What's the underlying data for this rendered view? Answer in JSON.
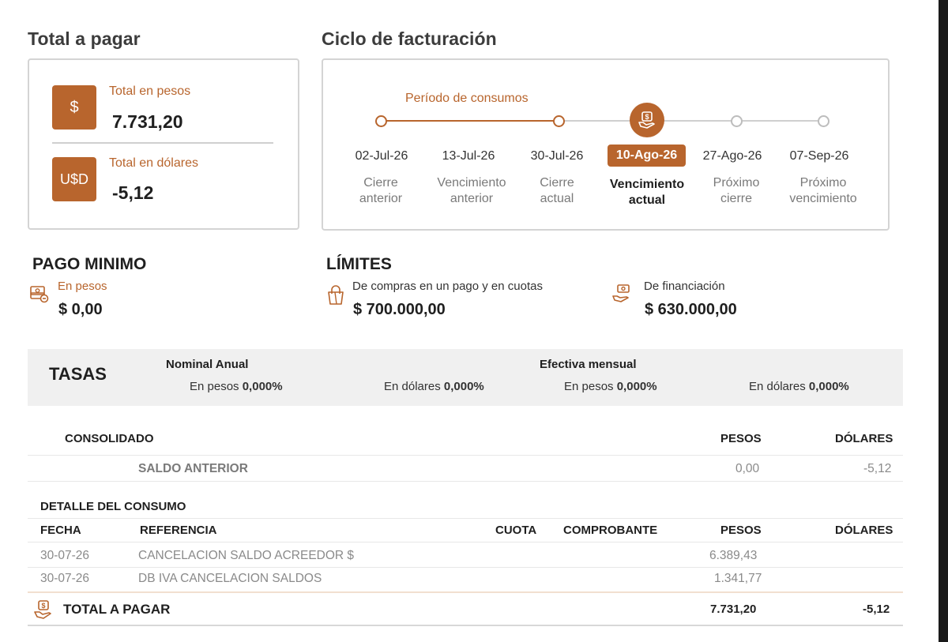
{
  "total": {
    "title": "Total a pagar",
    "pesos": {
      "icon": "dollar-sign-icon",
      "symbol": "$",
      "label": "Total en pesos",
      "value": "7.731,20"
    },
    "dolares": {
      "icon": "usd-sign-icon",
      "symbol": "U$D",
      "label": "Total en dólares",
      "value": "-5,12"
    }
  },
  "ciclo": {
    "title": "Ciclo de facturación",
    "period_label": "Período de consumos",
    "steps": [
      {
        "date": "02-Jul-26",
        "desc1": "Cierre",
        "desc2": "anterior"
      },
      {
        "date": "13-Jul-26",
        "desc1": "Vencimiento",
        "desc2": "anterior"
      },
      {
        "date": "30-Jul-26",
        "desc1": "Cierre",
        "desc2": "actual"
      },
      {
        "date": "10-Ago-26",
        "desc1": "Vencimiento",
        "desc2": "actual"
      },
      {
        "date": "27-Ago-26",
        "desc1": "Próximo",
        "desc2": "cierre"
      },
      {
        "date": "07-Sep-26",
        "desc1": "Próximo",
        "desc2": "vencimiento"
      }
    ]
  },
  "pago_minimo": {
    "title": "PAGO MINIMO",
    "label": "En pesos",
    "value": "$ 0,00"
  },
  "limites": {
    "title": "LÍMITES",
    "compras": {
      "label": "De compras en un pago y en cuotas",
      "value": "$ 700.000,00"
    },
    "financiacion": {
      "label": "De financiación",
      "value": "$ 630.000,00"
    }
  },
  "tasas": {
    "title": "TASAS",
    "nominal_title": "Nominal Anual",
    "efectiva_title": "Efectiva mensual",
    "en_pesos": "En pesos",
    "en_dolares": "En dólares",
    "value": "0,000%"
  },
  "consolidado": {
    "title": "CONSOLIDADO",
    "col_pesos": "PESOS",
    "col_dolares": "DÓLARES",
    "saldo_label": "SALDO ANTERIOR",
    "saldo_pesos": "0,00",
    "saldo_dolares": "-5,12"
  },
  "detalle": {
    "title": "DETALLE DEL CONSUMO",
    "headers": {
      "fecha": "FECHA",
      "referencia": "REFERENCIA",
      "cuota": "CUOTA",
      "comprobante": "COMPROBANTE",
      "pesos": "PESOS",
      "dolares": "DÓLARES"
    },
    "rows": [
      {
        "fecha": "30-07-26",
        "referencia": "CANCELACION SALDO ACREEDOR $",
        "pesos": "6.389,43"
      },
      {
        "fecha": "30-07-26",
        "referencia": "DB IVA CANCELACION SALDOS",
        "pesos": "1.341,77"
      }
    ],
    "total_label": "TOTAL A PAGAR",
    "total_pesos": "7.731,20",
    "total_dolares": "-5,12"
  }
}
